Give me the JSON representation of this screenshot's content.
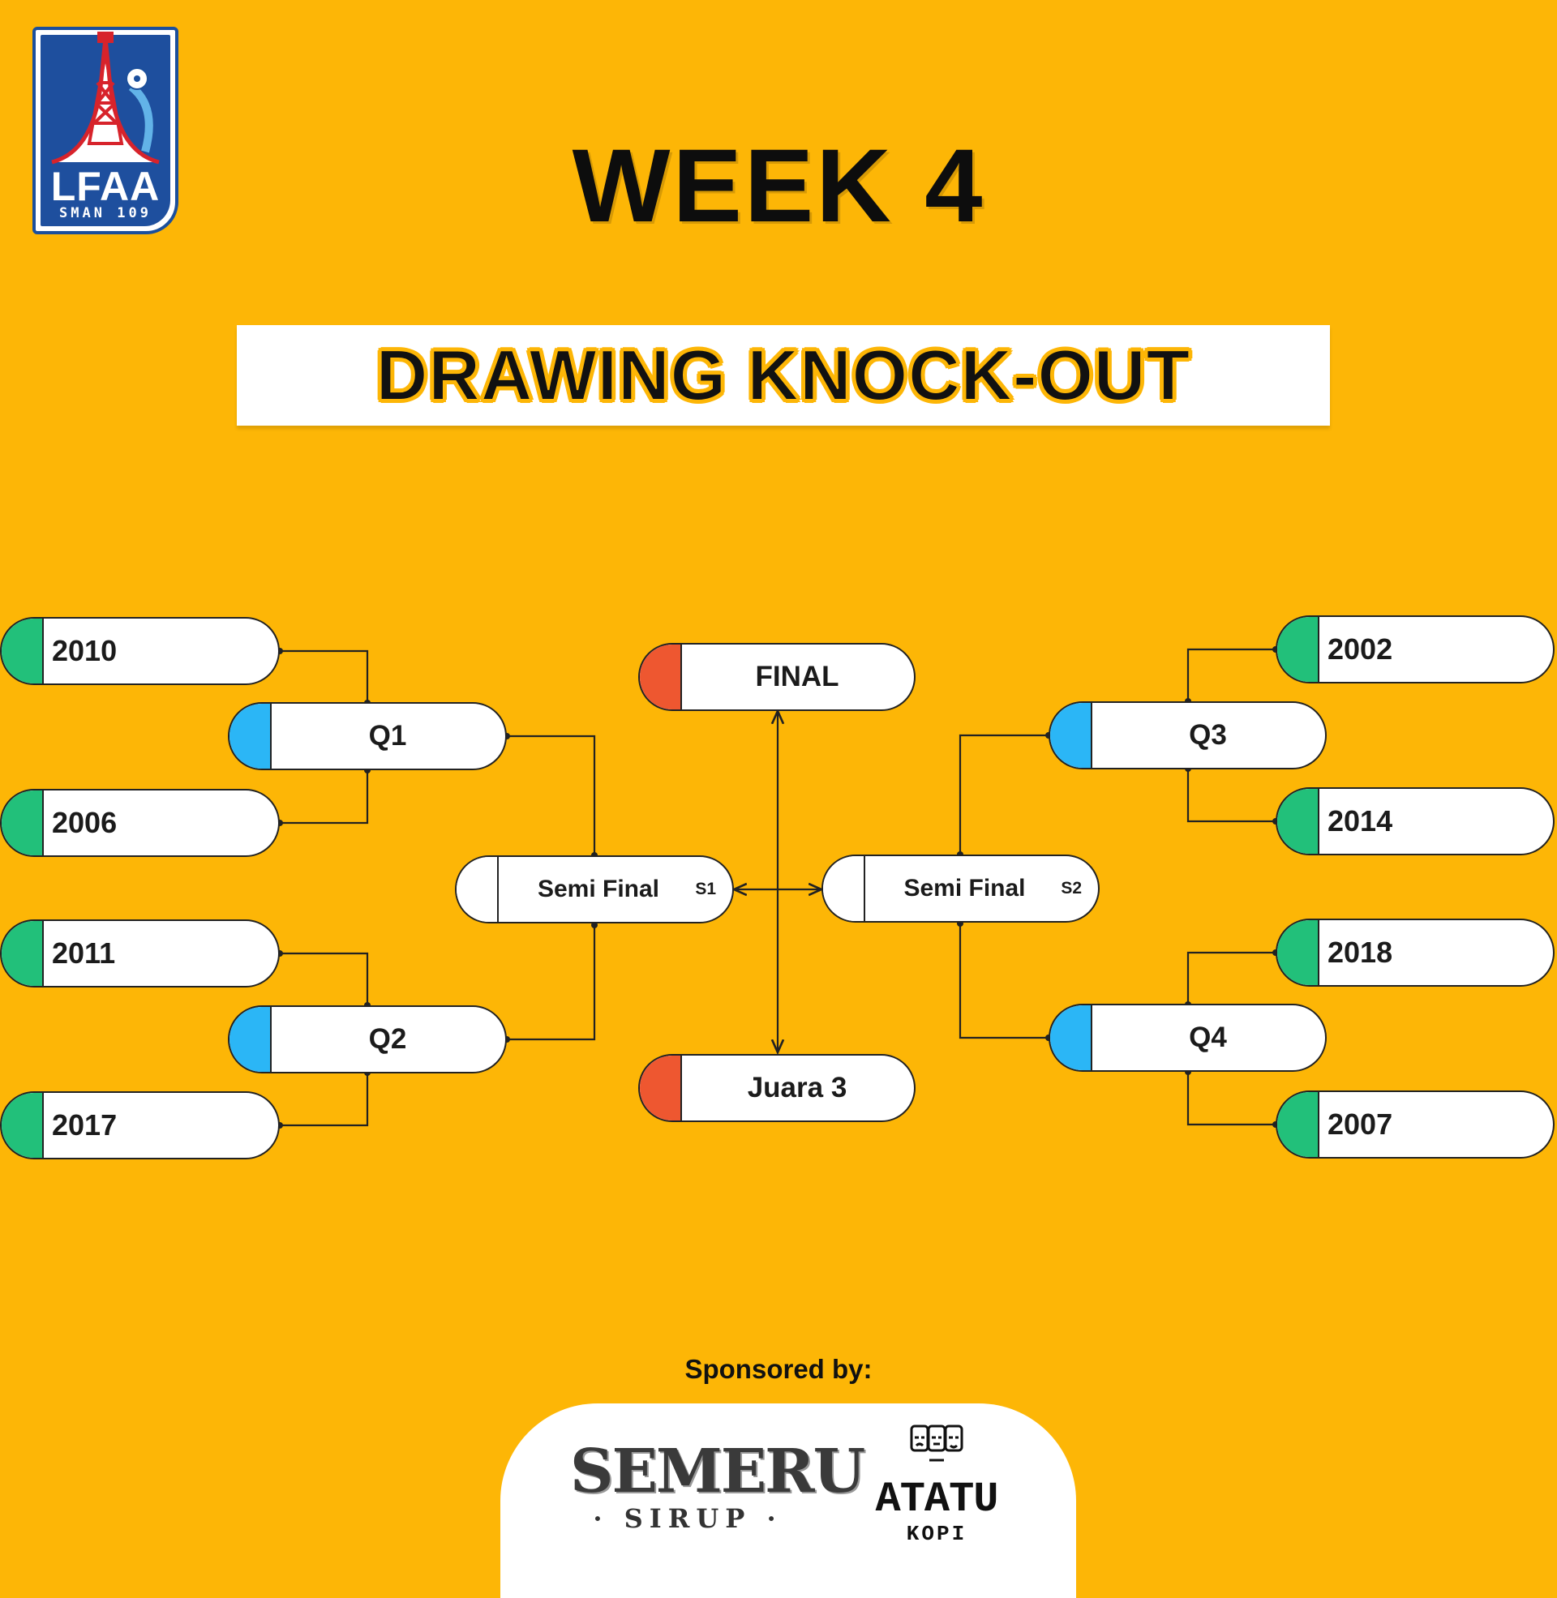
{
  "logo": {
    "text": "LFAA",
    "subtext": "SMAN 109"
  },
  "heading": {
    "week": "WEEK 4",
    "title": "DRAWING KNOCK-OUT"
  },
  "colors": {
    "background": "#FDB606",
    "team_cap": "#22C07A",
    "quarter_cap": "#2BB6F6",
    "final_cap": "#EE5730"
  },
  "bracket": {
    "left_teams": [
      "2010",
      "2006",
      "2011",
      "2017"
    ],
    "right_teams": [
      "2002",
      "2014",
      "2018",
      "2007"
    ],
    "quarters": [
      "Q1",
      "Q2",
      "Q3",
      "Q4"
    ],
    "semis": [
      {
        "label": "Semi Final",
        "tag": "S1"
      },
      {
        "label": "Semi Final",
        "tag": "S2"
      }
    ],
    "final": "FINAL",
    "third_place": "Juara 3"
  },
  "sponsors": {
    "heading": "Sponsored by:",
    "items": [
      {
        "name": "SEMERU",
        "sub": "SIRUP"
      },
      {
        "name": "ATATU",
        "sub": "KOPI"
      }
    ]
  }
}
